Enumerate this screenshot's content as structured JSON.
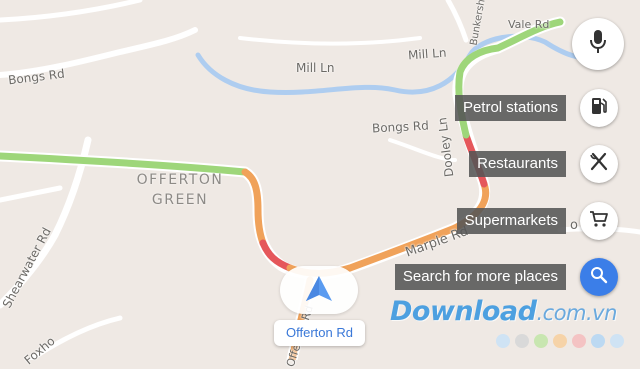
{
  "map": {
    "streets": {
      "bongs_rd_west": "Bongs Rd",
      "bongs_rd_east": "Bongs Rd",
      "mill_ln_1": "Mill Ln",
      "mill_ln_2": "Mill Ln",
      "vale_rd": "Vale Rd",
      "bunkershill": "Bunkershill",
      "dooley_ln": "Dooley Ln",
      "marple_rd": "Marple Rd",
      "shearwater_rd": "Shearwater Rd",
      "foxholes": "Foxho",
      "offerton_rd_vertical": "Offerton Rd",
      "partial_right": "o"
    },
    "area": {
      "line1": "OFFERTON",
      "line2": "GREEN"
    },
    "current_road": "Offerton Rd",
    "colors": {
      "land": "#efe9e4",
      "river": "#aecdf0",
      "route_orange": "#f0a25a",
      "route_red": "#e5575b",
      "route_green": "#9ed67a",
      "accent_blue": "#3b7ee8"
    }
  },
  "actions": [
    {
      "label": "Petrol stations",
      "icon": "gas-station-icon"
    },
    {
      "label": "Restaurants",
      "icon": "fork-knife-icon"
    },
    {
      "label": "Supermarkets",
      "icon": "shopping-cart-icon"
    },
    {
      "label": "Search for more places",
      "icon": "search-icon"
    }
  ],
  "voice": {
    "icon": "microphone-icon"
  },
  "navigation": {
    "icon": "navigation-arrow-icon"
  },
  "watermark": {
    "brand": "Download",
    "suffix": ".com.vn",
    "dot_colors": [
      "#cfe3f4",
      "#d9d9d9",
      "#c8e6b0",
      "#f6d3a8",
      "#f4c3c3",
      "#bcd9f2",
      "#cfe3f4"
    ]
  }
}
